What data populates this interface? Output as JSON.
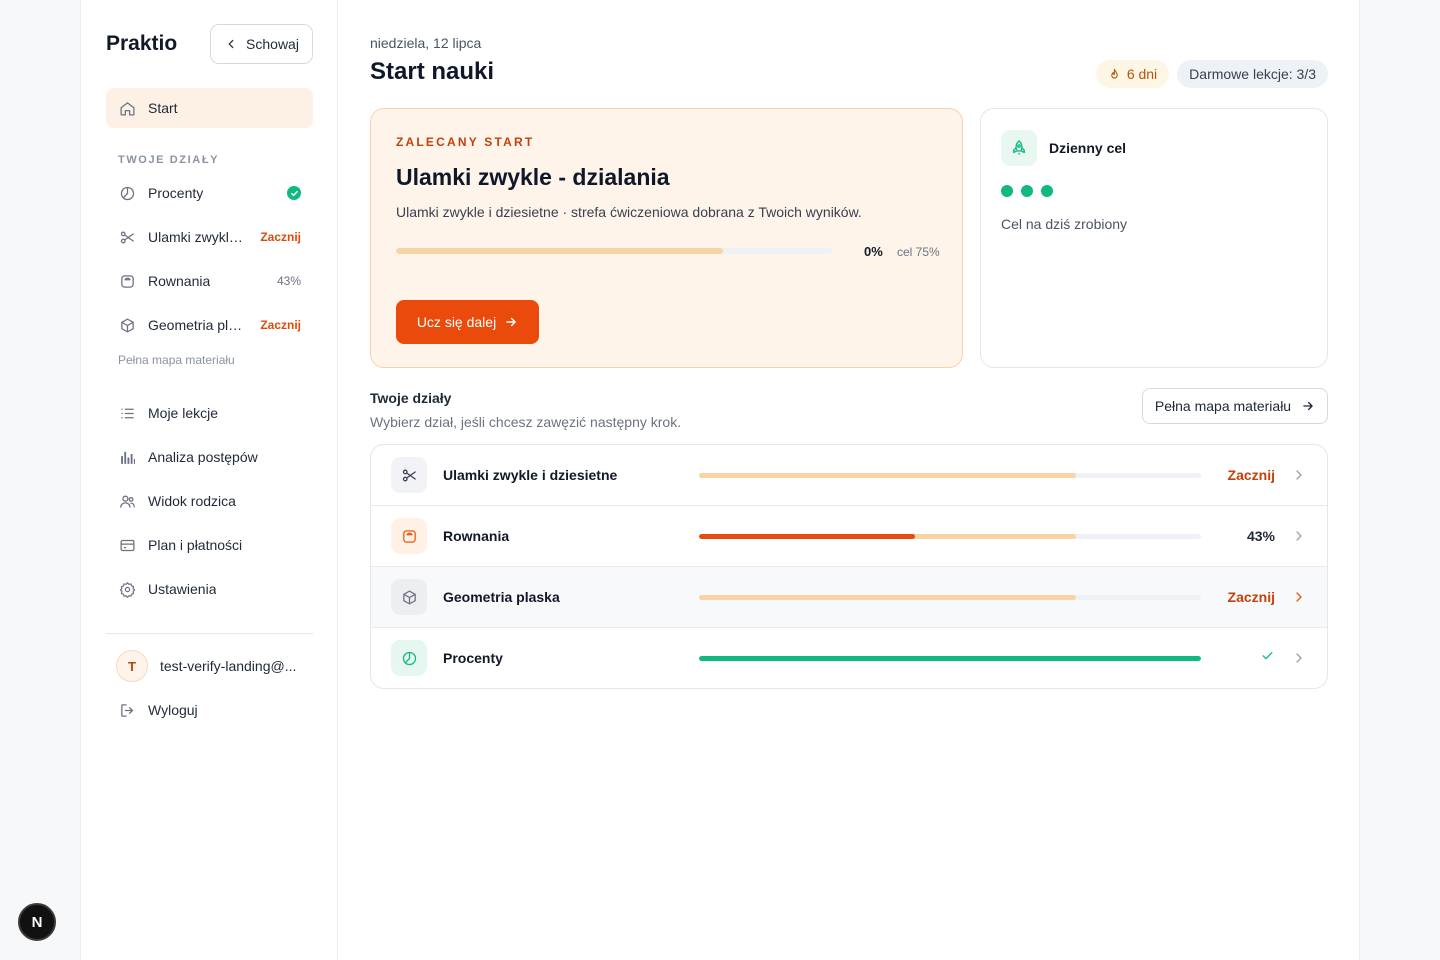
{
  "sidebar": {
    "brand": "Praktio",
    "hide_label": "Schowaj",
    "start_label": "Start",
    "sections_title": "TWOJE DZIAŁY",
    "topics": [
      {
        "label": "Procenty",
        "icon": "pie-chart-icon",
        "trail_type": "check"
      },
      {
        "label": "Ulamki zwykle i dziesietne",
        "icon": "scissors-icon",
        "trail_type": "orange",
        "trail": "Zacznij"
      },
      {
        "label": "Rownania",
        "icon": "scale-icon",
        "trail_type": "gray",
        "trail": "43%"
      },
      {
        "label": "Geometria plaska",
        "icon": "cube-icon",
        "trail_type": "orange",
        "trail": "Zacznij"
      }
    ],
    "map_link": "Pełna mapa materiału",
    "nav": [
      {
        "label": "Moje lekcje",
        "icon": "list-icon"
      },
      {
        "label": "Analiza postępów",
        "icon": "bar-chart-icon"
      },
      {
        "label": "Widok rodzica",
        "icon": "users-icon"
      },
      {
        "label": "Plan i płatności",
        "icon": "credit-card-icon"
      },
      {
        "label": "Ustawienia",
        "icon": "gear-icon"
      }
    ],
    "user": {
      "initial": "T",
      "email": "test-verify-landing@..."
    },
    "logout_label": "Wyloguj"
  },
  "header": {
    "date": "niedziela, 12 lipca",
    "title": "Start nauki",
    "streak": "6 dni",
    "free_lessons": "Darmowe lekcje: 3/3"
  },
  "hero": {
    "eyebrow": "ZALECANY START",
    "title": "Ulamki zwykle - dzialania",
    "description": "Ulamki zwykle i dziesietne · strefa ćwiczeniowa dobrana z Twoich wyników.",
    "progress_label": "0%",
    "progress": 0,
    "goal_label": "cel 75%",
    "goal": 0.75,
    "cta": "Ucz się dalej"
  },
  "daily_goal": {
    "title": "Dzienny cel",
    "dots_done": 3,
    "status": "Cel na dziś zrobiony"
  },
  "topics_section": {
    "title": "Twoje działy",
    "subtitle": "Wybierz dział, jeśli chcesz zawęzić następny krok.",
    "map_button": "Pełna mapa materiału",
    "rows": [
      {
        "name": "Ulamki zwykle i dziesietne",
        "icon": "scissors-icon",
        "progress": 0,
        "goal": 0.75,
        "status": "Zacznij",
        "status_type": "orange"
      },
      {
        "name": "Rownania",
        "icon": "scale-icon",
        "progress": 0.43,
        "goal": 0.75,
        "status": "43%",
        "status_type": "dark"
      },
      {
        "name": "Geometria plaska",
        "icon": "cube-icon",
        "progress": 0,
        "goal": 0.75,
        "status": "Zacznij",
        "status_type": "orange"
      },
      {
        "name": "Procenty",
        "icon": "pie-chart-icon",
        "progress": 1,
        "goal": 0.75,
        "status": "",
        "status_type": "check"
      }
    ]
  },
  "colors": {
    "accent": "#ea4a0b",
    "accent_text": "#c2410c",
    "success": "#10b981",
    "goal_track": "#f9d3a4",
    "hero_bg": "#fff4ea"
  },
  "dev_badge": "N"
}
